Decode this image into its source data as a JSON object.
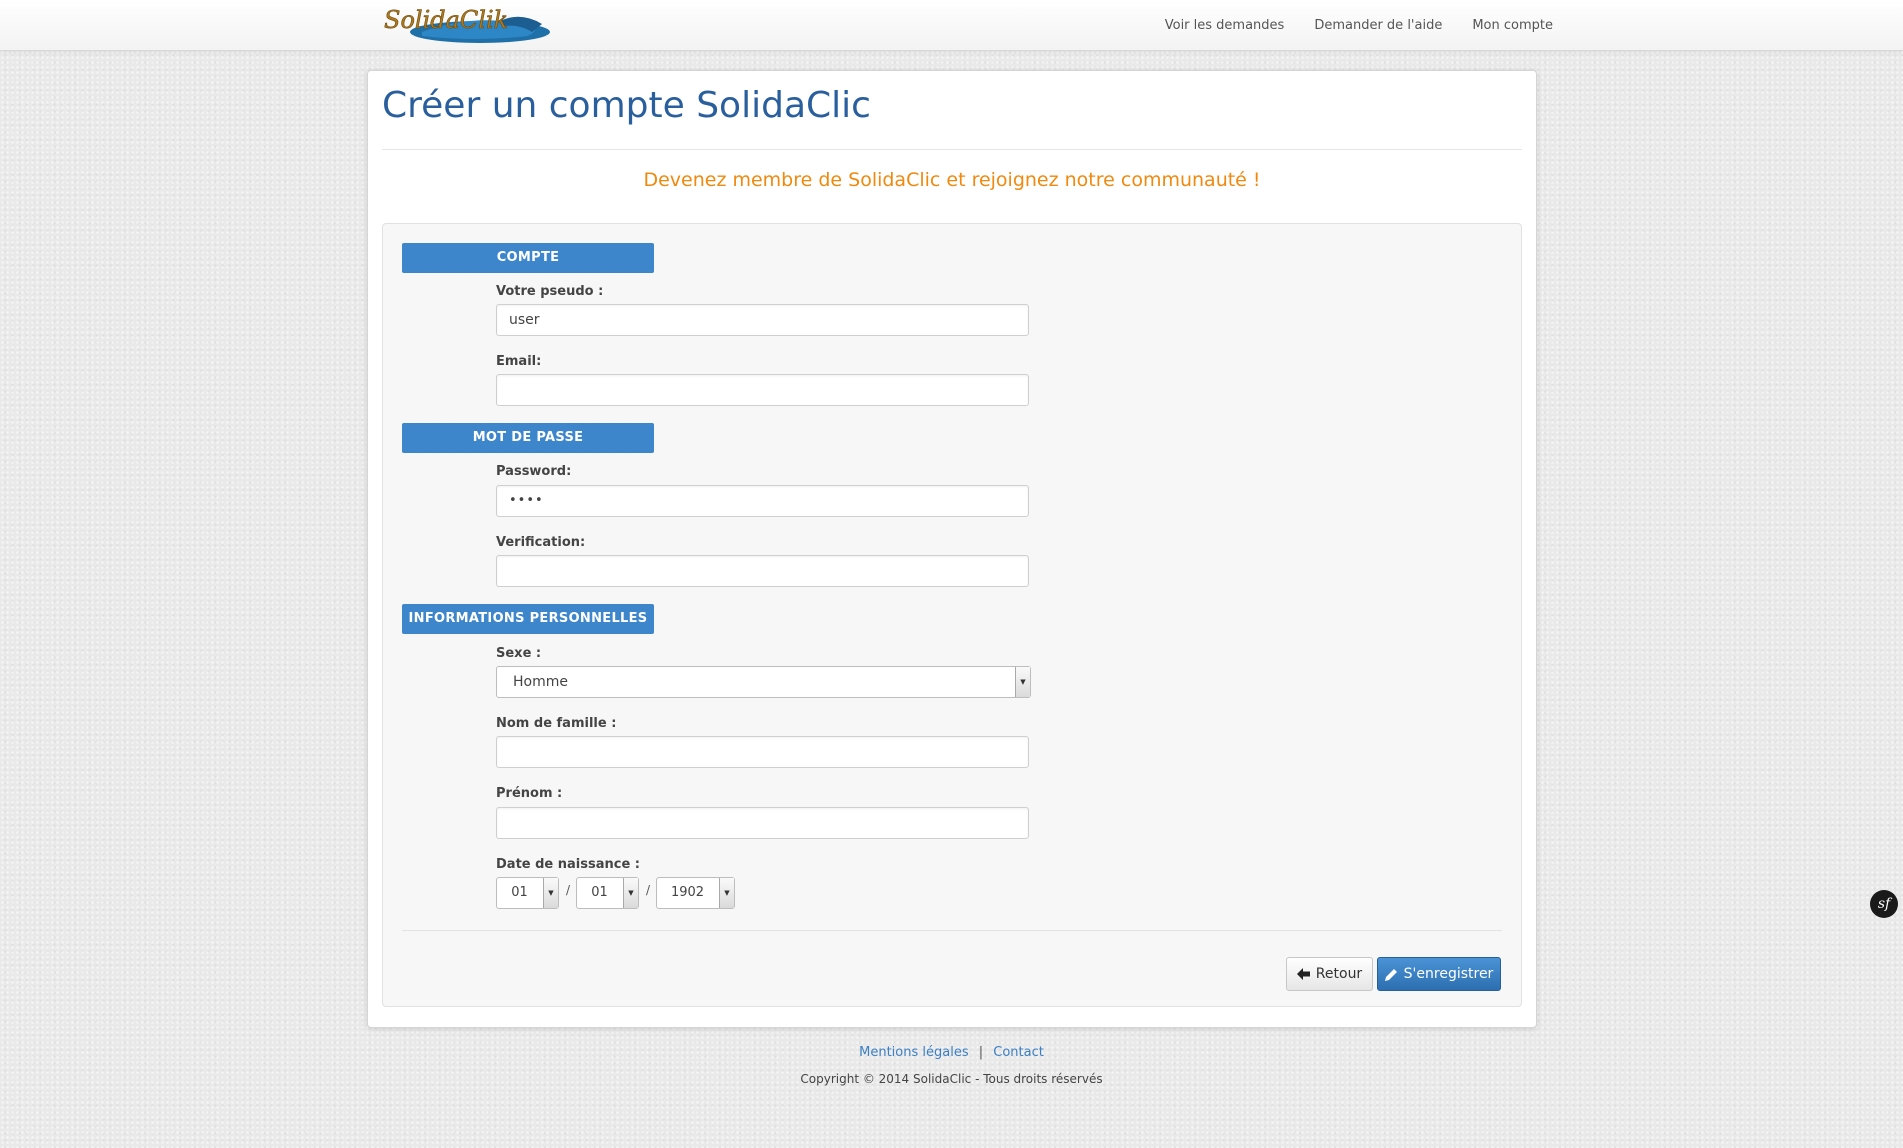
{
  "nav": {
    "logo_text": "SolidaClik",
    "links": [
      "Voir les demandes",
      "Demander de l'aide",
      "Mon compte"
    ]
  },
  "page": {
    "title": "Créer un compte SolidaClic",
    "tagline": "Devenez membre de SolidaClic et rejoignez notre communauté !"
  },
  "sections": {
    "account": "COMPTE",
    "password": "MOT DE PASSE",
    "personal": "INFORMATIONS PERSONNELLES"
  },
  "fields": {
    "pseudo": {
      "label": "Votre pseudo :",
      "value": "user"
    },
    "email": {
      "label": "Email:",
      "value": ""
    },
    "password": {
      "label": "Password:",
      "value": "••••"
    },
    "verification": {
      "label": "Verification:",
      "value": ""
    },
    "sexe": {
      "label": "Sexe :",
      "value": "Homme"
    },
    "nom": {
      "label": "Nom de famille :",
      "value": ""
    },
    "prenom": {
      "label": "Prénom :",
      "value": ""
    },
    "birthdate": {
      "label": "Date de naissance :",
      "day": "01",
      "month": "01",
      "year": "1902",
      "separator": "/"
    }
  },
  "buttons": {
    "back": "Retour",
    "register": "S'enregistrer"
  },
  "footer": {
    "legal": "Mentions légales",
    "separator": "|",
    "contact": "Contact",
    "copyright": "Copyright © 2014 SolidaClic - Tous droits réservés"
  },
  "badge": "sf",
  "colors": {
    "accent_blue": "#3e86cc",
    "title_blue": "#2a5f9e",
    "tagline_orange": "#f0890e"
  }
}
